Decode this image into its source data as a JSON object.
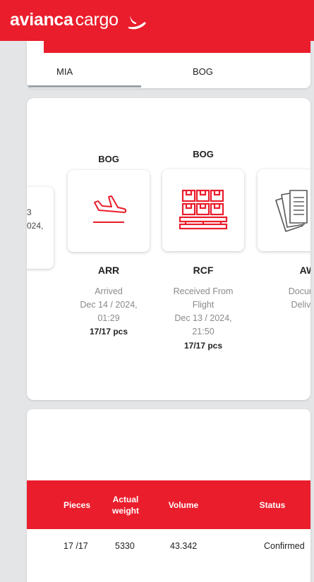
{
  "brand": {
    "bold": "avianca",
    "light": "cargo"
  },
  "route": {
    "origin": "MIA",
    "destination": "BOG"
  },
  "timeline": {
    "partial_first": {
      "line1": "3",
      "line2": "024,"
    },
    "events": [
      {
        "location": "BOG",
        "code": "ARR",
        "icon": "airplane-landing-icon",
        "status": "Arrived",
        "date": "Dec 14 / 2024,",
        "time": "01:29",
        "pieces": "17/17 pcs"
      },
      {
        "location": "BOG",
        "code": "RCF",
        "icon": "pallet-boxes-icon",
        "status_line1": "Received From",
        "status_line2": "Flight",
        "date": "Dec 13 / 2024,",
        "time": "21:50",
        "pieces": "17/17 pcs"
      },
      {
        "code": "AWD",
        "icon": "documents-icon",
        "status_line1": "Docume",
        "status_line2": "Deliver"
      }
    ]
  },
  "summary": {
    "headers": {
      "pieces": "Pieces",
      "weight_line1": "Actual",
      "weight_line2": "weight",
      "volume": "Volume",
      "status": "Status"
    },
    "row": {
      "pieces": "17 /17",
      "weight": "5330",
      "volume": "43.342",
      "status": "Confirmed"
    }
  },
  "colors": {
    "brand_red": "#ea1d2c",
    "background": "#e4e5e7",
    "muted_text": "#8a8a8a"
  }
}
